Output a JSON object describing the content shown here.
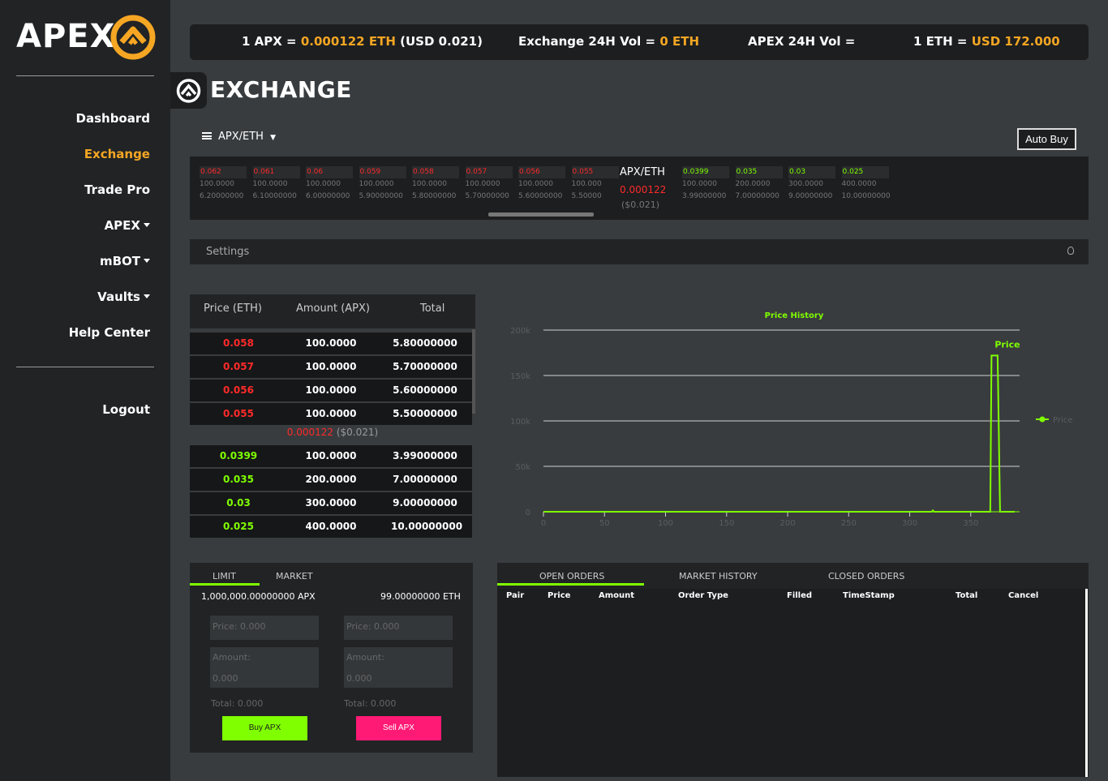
{
  "logo": {
    "text": "APEX"
  },
  "sidebar": {
    "items": [
      {
        "label": "Dashboard"
      },
      {
        "label": "Exchange"
      },
      {
        "label": "Trade Pro"
      },
      {
        "label": "APEX"
      },
      {
        "label": "mBOT"
      },
      {
        "label": "Vaults"
      },
      {
        "label": "Help Center"
      }
    ],
    "logout": "Logout"
  },
  "ticker": {
    "apx_label": "1 APX =",
    "apx_eth": "0.000122 ETH",
    "apx_usd": "(USD 0.021)",
    "exvol_label": "Exchange 24H Vol =",
    "exvol_value": "0 ETH",
    "apexvol_label": "APEX 24H Vol =",
    "eth_label": "1 ETH =",
    "eth_usd": "USD 172.000"
  },
  "header": {
    "title": "EXCHANGE",
    "pair_select": "APX/ETH",
    "auto_buy": "Auto Buy"
  },
  "strip": {
    "asks": [
      {
        "price": "0.062",
        "amount": "100.0000",
        "total": "6.20000000"
      },
      {
        "price": "0.061",
        "amount": "100.0000",
        "total": "6.10000000"
      },
      {
        "price": "0.06",
        "amount": "100.0000",
        "total": "6.00000000"
      },
      {
        "price": "0.059",
        "amount": "100.0000",
        "total": "5.90000000"
      },
      {
        "price": "0.058",
        "amount": "100.0000",
        "total": "5.80000000"
      },
      {
        "price": "0.057",
        "amount": "100.0000",
        "total": "5.70000000"
      },
      {
        "price": "0.056",
        "amount": "100.0000",
        "total": "5.60000000"
      },
      {
        "price": "0.055",
        "amount": "100.000",
        "total": "5.50000"
      }
    ],
    "pair": "APX/ETH",
    "last_price": "0.000122",
    "last_usd": "($0.021)",
    "bids": [
      {
        "price": "0.0399",
        "amount": "100.0000",
        "total": "3.99000000"
      },
      {
        "price": "0.035",
        "amount": "200.0000",
        "total": "7.00000000"
      },
      {
        "price": "0.03",
        "amount": "300.0000",
        "total": "9.00000000"
      },
      {
        "price": "0.025",
        "amount": "400.0000",
        "total": "10.00000000"
      }
    ]
  },
  "settings": {
    "label": "Settings"
  },
  "orderbook": {
    "headers": [
      "Price (ETH)",
      "Amount (APX)",
      "Total"
    ],
    "asks": [
      {
        "price": "0.058",
        "amount": "100.0000",
        "total": "5.80000000"
      },
      {
        "price": "0.057",
        "amount": "100.0000",
        "total": "5.70000000"
      },
      {
        "price": "0.056",
        "amount": "100.0000",
        "total": "5.60000000"
      },
      {
        "price": "0.055",
        "amount": "100.0000",
        "total": "5.50000000"
      }
    ],
    "last_price": "0.000122",
    "last_usd": "($0.021)",
    "bids": [
      {
        "price": "0.0399",
        "amount": "100.0000",
        "total": "3.99000000"
      },
      {
        "price": "0.035",
        "amount": "200.0000",
        "total": "7.00000000"
      },
      {
        "price": "0.03",
        "amount": "300.0000",
        "total": "9.00000000"
      },
      {
        "price": "0.025",
        "amount": "400.0000",
        "total": "10.00000000"
      }
    ]
  },
  "chart_data": {
    "type": "line",
    "title": "Price History",
    "xlabel": "",
    "ylabel": "",
    "xlim": [
      0,
      390
    ],
    "ylim": [
      0,
      200000
    ],
    "x_ticks": [
      "0",
      "50",
      "100",
      "150",
      "200",
      "250",
      "300",
      "350"
    ],
    "y_ticks": [
      "0",
      "50k",
      "100k",
      "150k",
      "200k"
    ],
    "grid": true,
    "legend_position": "right",
    "series": [
      {
        "name": "Price",
        "color": "#7fff00",
        "x": [
          0,
          318,
          319,
          320,
          366,
          367,
          368,
          370,
          371,
          372,
          374,
          386
        ],
        "y": [
          0,
          0,
          1500,
          0,
          0,
          172000,
          172000,
          172000,
          172000,
          172000,
          0,
          0
        ]
      }
    ],
    "annotation": "Price"
  },
  "trade": {
    "tabs": [
      "LIMIT",
      "MARKET"
    ],
    "balance_apx": "1,000,000.00000000 APX",
    "balance_eth": "99.00000000 ETH",
    "buy": {
      "price_ph": "Price: 0.000",
      "amount_ph": "Amount:",
      "amount_val": "0.000",
      "total": "Total: 0.000",
      "button": "Buy APX"
    },
    "sell": {
      "price_ph": "Price: 0.000",
      "amount_ph": "Amount:",
      "amount_val": "0.000",
      "total": "Total: 0.000",
      "button": "Sell APX"
    },
    "buy_color": "#7fff00",
    "sell_color": "#ff1a75"
  },
  "orders": {
    "tabs": [
      "OPEN ORDERS",
      "MARKET HISTORY",
      "CLOSED ORDERS"
    ],
    "columns": [
      "Pair",
      "Price",
      "Amount",
      "Order Type",
      "Filled",
      "TimeStamp",
      "Total",
      "Cancel"
    ]
  },
  "colors": {
    "accent": "#f5a623",
    "up": "#7fff00",
    "down": "#ff2a2a"
  }
}
